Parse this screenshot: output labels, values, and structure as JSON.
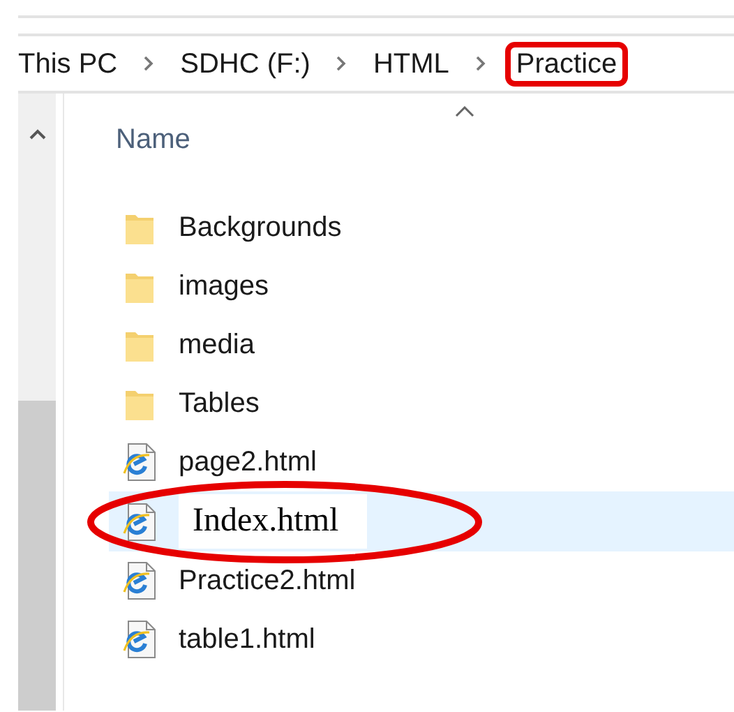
{
  "breadcrumb": [
    {
      "label": "This PC",
      "highlighted": false
    },
    {
      "label": "SDHC (F:)",
      "highlighted": false
    },
    {
      "label": "HTML",
      "highlighted": false
    },
    {
      "label": "Practice",
      "highlighted": true
    }
  ],
  "column": {
    "label": "Name"
  },
  "files": [
    {
      "name": "Backgrounds",
      "kind": "folder",
      "selected": false,
      "circled": false
    },
    {
      "name": "images",
      "kind": "folder",
      "selected": false,
      "circled": false
    },
    {
      "name": "media",
      "kind": "folder",
      "selected": false,
      "circled": false
    },
    {
      "name": "Tables",
      "kind": "folder",
      "selected": false,
      "circled": false
    },
    {
      "name": "page2.html",
      "kind": "html",
      "selected": false,
      "circled": false
    },
    {
      "name": "Index.html",
      "kind": "html",
      "selected": true,
      "circled": true
    },
    {
      "name": "Practice2.html",
      "kind": "html",
      "selected": false,
      "circled": false
    },
    {
      "name": "table1.html",
      "kind": "html",
      "selected": false,
      "circled": false
    }
  ]
}
